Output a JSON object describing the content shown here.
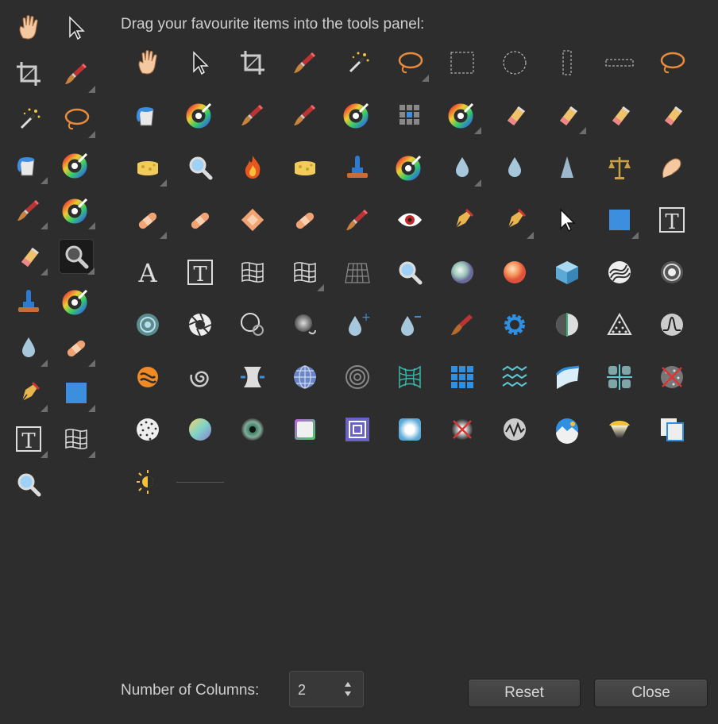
{
  "dialog": {
    "instruction": "Drag your favourite items into the tools panel:",
    "columns_label": "Number of Columns:",
    "columns_value": "2",
    "reset_label": "Reset",
    "close_label": "Close"
  },
  "tools_panel": [
    "hand-icon",
    "pointer-icon",
    "crop-icon",
    "paint-brush-icon",
    "magic-wand-icon",
    "lasso-icon",
    "fill-bucket-icon",
    "color-wheel-icon",
    "brush-icon",
    "mixer-brush-icon",
    "eraser-icon",
    "zoom-icon",
    "clone-stamp-icon",
    "retouch-brush-icon",
    "blur-drop-icon",
    "patch-bandage-icon",
    "pen-icon",
    "rectangle-icon",
    "text-frame-icon",
    "mesh-warp-icon",
    "zoom-icon"
  ],
  "available_tools": [
    "hand-icon",
    "pointer-icon",
    "crop-icon",
    "paint-brush-icon",
    "magic-wand-icon",
    "lasso-icon",
    "marquee-rect-icon",
    "marquee-ellipse-icon",
    "marquee-column-icon",
    "marquee-row-icon",
    "freehand-lasso-icon",
    "fill-bucket-icon",
    "color-wheel-icon",
    "brush-icon",
    "brush-icon",
    "mixer-brush-icon",
    "grid-icon",
    "color-replace-brush-icon",
    "eraser-icon",
    "eraser-icon",
    "background-eraser-icon",
    "flood-eraser-icon",
    "sponge-icon",
    "zoom-icon",
    "burn-icon",
    "sponge-icon",
    "clone-stamp-icon",
    "retouch-brush-icon",
    "blur-drop-icon",
    "sharpen-drop-icon",
    "smudge-cone-icon",
    "balance-icon",
    "smudge-hand-icon",
    "patch-bandage-icon",
    "patch-bandage-icon",
    "inpaint-diamond-icon",
    "selection-bandage-icon",
    "selection-brush-icon",
    "red-eye-icon",
    "pen-icon",
    "pen-icon",
    "node-pointer-icon",
    "rectangle-icon",
    "text-frame-icon",
    "artistic-text-icon",
    "text-frame-icon",
    "mesh-warp-icon",
    "mesh-warp-icon",
    "perspective-grid-icon",
    "zoom-icon",
    "sphere-icon",
    "orange-sphere-icon",
    "cube-icon",
    "swirl-icon",
    "ripple-icon",
    "emboss-icon",
    "aperture-icon",
    "lens-icon",
    "blur-glow-icon",
    "dodge-drop-icon",
    "burn-drop-icon",
    "paint-mixer-icon",
    "gear-icon",
    "halftone-split-icon",
    "triangle-dots-icon",
    "curve-icon",
    "orange-swirl-icon",
    "twirl-icon",
    "pinch-icon",
    "globe-icon",
    "spiral-icon",
    "mesh-wave-icon",
    "pixel-grid-icon",
    "zigzag-icon",
    "shear-icon",
    "split-icon",
    "remove-noise-icon",
    "noise-icon",
    "gradient-sphere-icon",
    "eye-icon",
    "square-glow-icon",
    "nested-squares-icon",
    "vignette-square-icon",
    "cross-icon",
    "waveform-icon",
    "landscape-icon",
    "lamp-icon",
    "duplicate-icon",
    "exposure-icon"
  ]
}
